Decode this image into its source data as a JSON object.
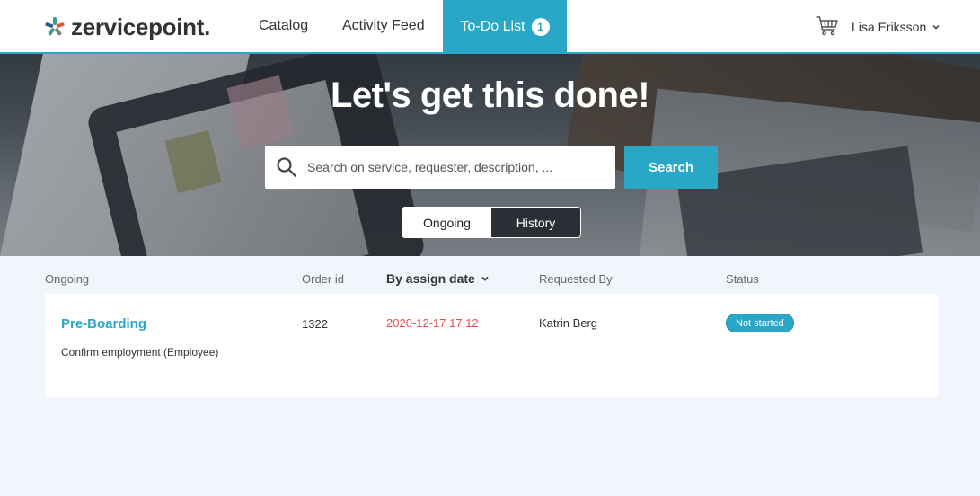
{
  "brand": {
    "name": "zervicepoint."
  },
  "nav": {
    "catalog": "Catalog",
    "activity": "Activity Feed",
    "todo": "To-Do List",
    "todo_count": "1"
  },
  "user": {
    "name": "Lisa Eriksson"
  },
  "hero": {
    "title": "Let's get this done!",
    "search_placeholder": "Search on service, requester, description, ...",
    "search_button": "Search",
    "toggle": {
      "ongoing": "Ongoing",
      "history": "History",
      "active": "Ongoing"
    }
  },
  "table": {
    "headers": {
      "group": "Ongoing",
      "order_id": "Order id",
      "sort": "By assign date",
      "requested_by": "Requested By",
      "status": "Status"
    },
    "rows": [
      {
        "title": "Pre-Boarding",
        "subtitle": "Confirm employment (Employee)",
        "order_id": "1322",
        "date": "2020-12-17 17:12",
        "requested_by": "Katrin Berg",
        "status": "Not started"
      }
    ]
  },
  "colors": {
    "accent": "#29a7c7",
    "date": "#d9534f"
  },
  "icons": [
    "logo-mark-icon",
    "cart-icon",
    "chevron-down-icon",
    "search-icon"
  ]
}
